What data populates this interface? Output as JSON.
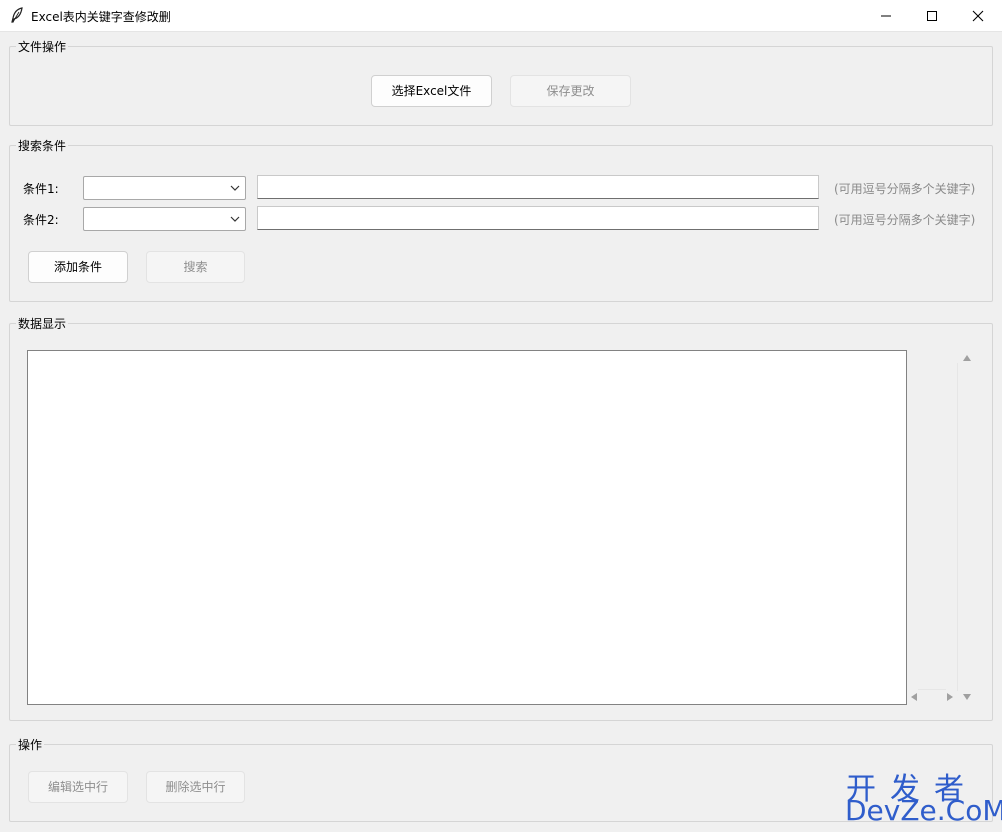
{
  "window": {
    "title": "Excel表内关键字查修改删",
    "icon": "feather-icon",
    "controls": [
      "minimize-icon",
      "maximize-icon",
      "close-icon"
    ]
  },
  "file_ops": {
    "legend": "文件操作",
    "select_button": "选择Excel文件",
    "save_button": "保存更改"
  },
  "search": {
    "legend": "搜索条件",
    "conditions": [
      {
        "label": "条件1:",
        "column_value": "",
        "keyword_value": "",
        "hint": "(可用逗号分隔多个关键字)"
      },
      {
        "label": "条件2:",
        "column_value": "",
        "keyword_value": "",
        "hint": "(可用逗号分隔多个关键字)"
      }
    ],
    "add_button": "添加条件",
    "search_button": "搜索"
  },
  "data_display": {
    "legend": "数据显示"
  },
  "actions": {
    "legend": "操作",
    "edit_button": "编辑选中行",
    "delete_button": "删除选中行"
  },
  "watermark": {
    "line1": "开发者",
    "line2": "DevZe.CoM"
  },
  "colors": {
    "background": "#f0f0f0",
    "watermark": "#2f5dcb",
    "disabled_text": "#8e8e8e"
  }
}
